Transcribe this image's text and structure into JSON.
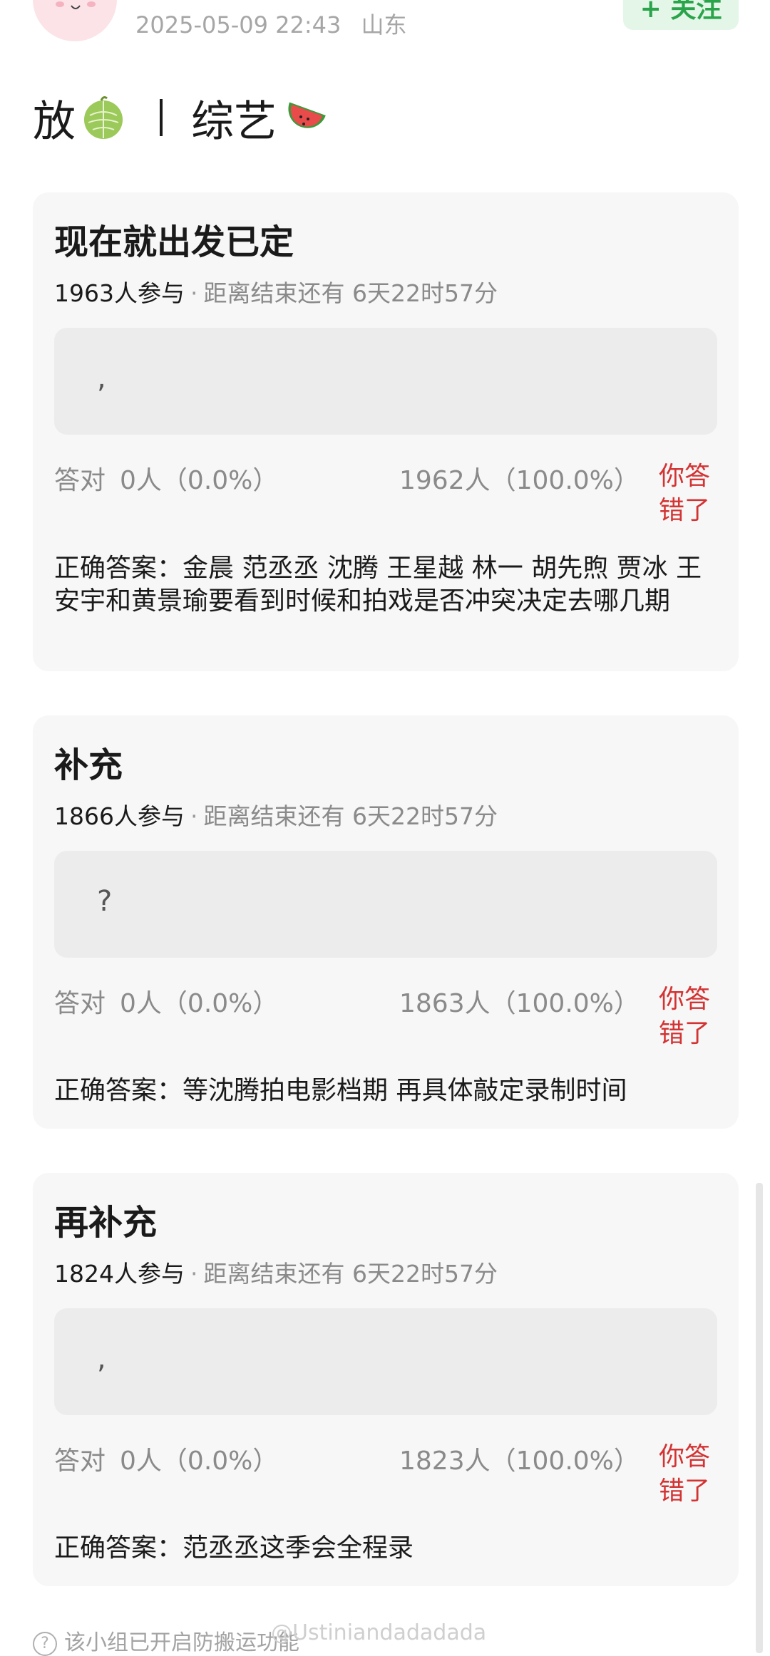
{
  "post": {
    "datetime": "2025-05-09 22:43",
    "location": "山东",
    "follow_label": "+ 关注"
  },
  "title": {
    "left": "放",
    "right": "综艺"
  },
  "polls": [
    {
      "title": "现在就出发已定",
      "participants": "1963人参与",
      "remaining": "距离结束还有 6天22时57分",
      "answer_text": ",",
      "correct_label": "答对",
      "correct_stat": "0人（0.0%）",
      "wrong_stat": "1962人（100.0%）",
      "verdict": "你答错了",
      "correct_answer": "正确答案：金晨 范丞丞 沈腾 王星越 林一 胡先煦 贾冰 王安宇和黄景瑜要看到时候和拍戏是否冲突决定去哪几期"
    },
    {
      "title": "补充",
      "participants": "1866人参与",
      "remaining": "距离结束还有 6天22时57分",
      "answer_text": "?",
      "correct_label": "答对",
      "correct_stat": "0人（0.0%）",
      "wrong_stat": "1863人（100.0%）",
      "verdict": "你答错了",
      "correct_answer": "正确答案：等沈腾拍电影档期 再具体敲定录制时间"
    },
    {
      "title": "再补充",
      "participants": "1824人参与",
      "remaining": "距离结束还有 6天22时57分",
      "answer_text": ",",
      "correct_label": "答对",
      "correct_stat": "0人（0.0%）",
      "wrong_stat": "1823人（100.0%）",
      "verdict": "你答错了",
      "correct_answer": "正确答案：范丞丞这季会全程录"
    }
  ],
  "footer": {
    "note": "该小组已开启防搬运功能",
    "watermark": "@Ustiniandadadada"
  },
  "colors": {
    "follow_bg": "#e3f6e8",
    "follow_text": "#2aa44a",
    "wrong_red": "#d33333",
    "card_bg": "#f7f7f7"
  }
}
